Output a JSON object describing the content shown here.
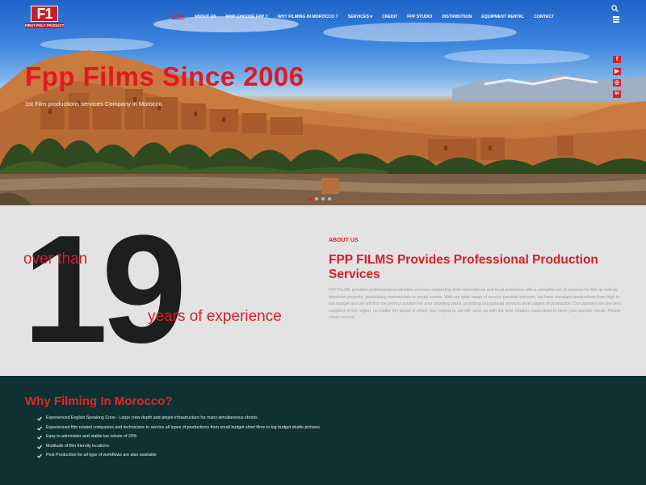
{
  "brand": {
    "logo_number": "F1",
    "logo_text": "FIRST POLY PRODUCTION"
  },
  "nav": [
    {
      "label": "HOME",
      "active": true
    },
    {
      "label": "ABOUT US",
      "active": false
    },
    {
      "label": "WHY CHOOSE FPP ?",
      "active": false
    },
    {
      "label": "WHY FILMING IN MOROCCO ?",
      "active": false
    },
    {
      "label": "SERVICES ▾",
      "active": false
    },
    {
      "label": "CREDIT",
      "active": false
    },
    {
      "label": "FPP STUDIO",
      "active": false
    },
    {
      "label": "DISTRIBUTION",
      "active": false
    },
    {
      "label": "EQUIPMENT RENTAL",
      "active": false
    },
    {
      "label": "CONTACT",
      "active": false
    }
  ],
  "hero": {
    "title": "Fpp Films Since 2006",
    "subtitle": "1st Film productions services Company in Morocco",
    "slides": 4,
    "active_slide": 0
  },
  "social": [
    {
      "name": "facebook",
      "glyph": "f"
    },
    {
      "name": "youtube",
      "glyph": "▶"
    },
    {
      "name": "instagram",
      "glyph": "◎"
    },
    {
      "name": "linkedin",
      "glyph": "in"
    }
  ],
  "stats": {
    "prefix": "over than",
    "number": "19",
    "suffix": "years of experience"
  },
  "about": {
    "label": "ABOUT US",
    "heading": "FPP FILMS Provides Professional Production Services",
    "text": "FPP FILMS provides professional production services supporting both international and local producers with a complete set of services for film as well as television projects, advertising commercials or social events. With our wide range of service provider partners, we have managed productions from high to low budget and we will find the perfect solution for your shooting plans, providing exceptional services at all stages of production. Our partners are the best suppliers in the region, no matter the phase in which your project is, we will come up with the best solution customized to meet your specific needs. Please check service"
  },
  "why": {
    "title": "Why Filming In Morocco?",
    "items": [
      "Experienced English Speaking Crew - Large crew depth and ample infrastructure for many simultaneous shoots",
      "Experienced film related companies and technicians to service all types of productions from small budget short films to big budget studio pictures",
      "Easy to administer and stable tax rebate of 20%",
      "Multitude of film friendly locations",
      "Post Production for all type of workflows are also available"
    ]
  },
  "colors": {
    "accent": "#d21f26",
    "dark_teal": "#0e3234",
    "light_gray": "#e3e3e3"
  }
}
